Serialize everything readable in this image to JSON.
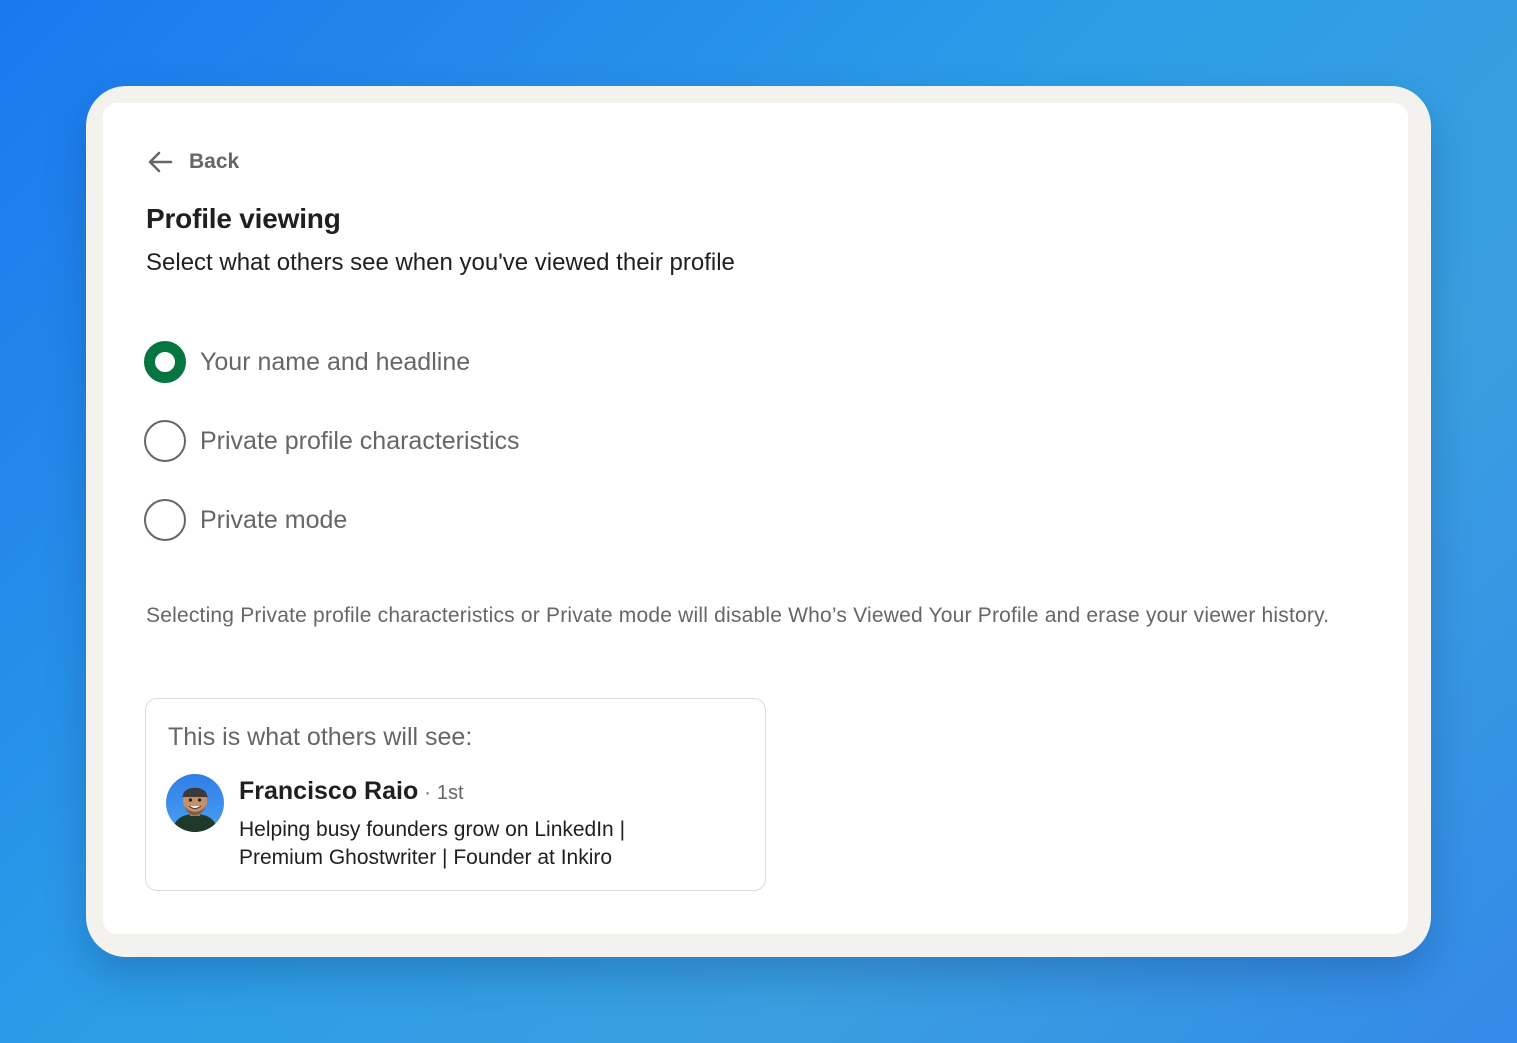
{
  "back": {
    "label": "Back",
    "icon": "arrow-left-icon"
  },
  "header": {
    "title": "Profile viewing",
    "subtitle": "Select what others see when you've viewed their profile"
  },
  "options": [
    {
      "label": "Your name and headline",
      "selected": true
    },
    {
      "label": "Private profile characteristics",
      "selected": false
    },
    {
      "label": "Private mode",
      "selected": false
    }
  ],
  "notice": "Selecting Private profile characteristics or Private mode will disable Who’s Viewed Your Profile and erase your viewer history.",
  "preview": {
    "heading": "This is what others will see:",
    "name": "Francisco Raio",
    "separator": "·",
    "degree": "1st",
    "headline": "Helping busy founders grow on LinkedIn | Premium Ghostwriter | Founder at Inkiro"
  },
  "colors": {
    "accent": "#057642",
    "text_primary": "#1f1f1f",
    "text_secondary": "#666666",
    "frame": "#f3f2ef"
  }
}
